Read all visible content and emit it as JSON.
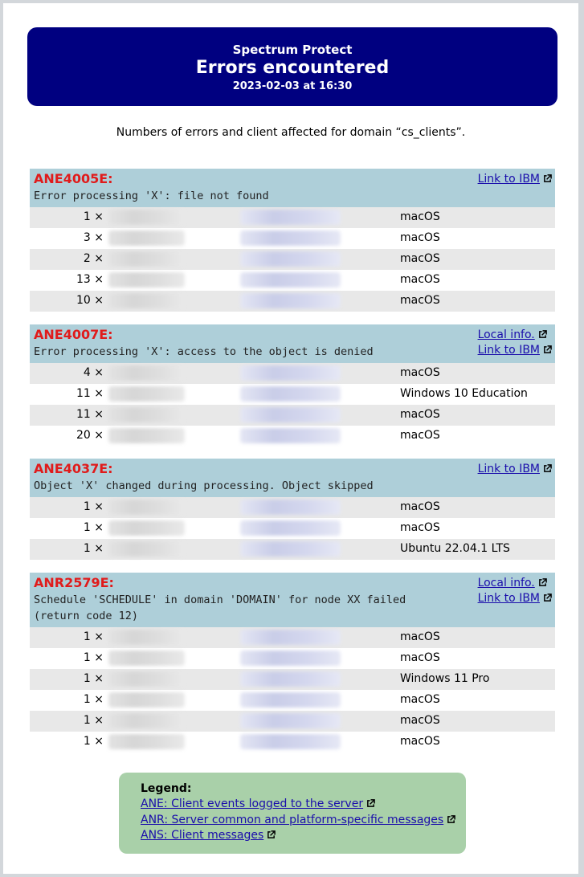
{
  "header": {
    "app": "Spectrum Protect",
    "title": "Errors encountered",
    "datetime": "2023-02-03 at 16:30"
  },
  "subtitle": "Numbers of errors and client affected for domain “cs_clients”.",
  "colors": {
    "banner": "#000080",
    "error_code": "#e01b1b",
    "group_header": "#aecfd9",
    "legend_bg": "#a9d0a9",
    "link": "#1a0dab"
  },
  "groups": [
    {
      "code": "ANE4005E:",
      "description": "Error processing 'X': file not found",
      "links": [
        "Link to IBM"
      ],
      "rows": [
        {
          "count": "1 ×",
          "os": "macOS"
        },
        {
          "count": "3 ×",
          "os": "macOS"
        },
        {
          "count": "2 ×",
          "os": "macOS"
        },
        {
          "count": "13 ×",
          "os": "macOS"
        },
        {
          "count": "10 ×",
          "os": "macOS"
        }
      ]
    },
    {
      "code": "ANE4007E:",
      "description": "Error processing 'X': access to the object is denied",
      "links": [
        "Local info.",
        "Link to IBM"
      ],
      "rows": [
        {
          "count": "4 ×",
          "os": "macOS"
        },
        {
          "count": "11 ×",
          "os": "Windows 10 Education"
        },
        {
          "count": "11 ×",
          "os": "macOS"
        },
        {
          "count": "20 ×",
          "os": "macOS"
        }
      ]
    },
    {
      "code": "ANE4037E:",
      "description": "Object 'X' changed during processing. Object skipped",
      "links": [
        "Link to IBM"
      ],
      "rows": [
        {
          "count": "1 ×",
          "os": "macOS"
        },
        {
          "count": "1 ×",
          "os": "macOS"
        },
        {
          "count": "1 ×",
          "os": "Ubuntu 22.04.1 LTS"
        }
      ]
    },
    {
      "code": "ANR2579E:",
      "description": "Schedule 'SCHEDULE' in domain 'DOMAIN' for node XX failed (return code 12)",
      "description_lines": [
        "Schedule 'SCHEDULE' in domain 'DOMAIN' for node XX failed",
        "(return code 12)"
      ],
      "links": [
        "Local info.",
        "Link to IBM"
      ],
      "rows": [
        {
          "count": "1 ×",
          "os": "macOS"
        },
        {
          "count": "1 ×",
          "os": "macOS"
        },
        {
          "count": "1 ×",
          "os": "Windows 11 Pro"
        },
        {
          "count": "1 ×",
          "os": "macOS"
        },
        {
          "count": "1 ×",
          "os": "macOS"
        },
        {
          "count": "1 ×",
          "os": "macOS"
        }
      ]
    }
  ],
  "legend": {
    "title": "Legend:",
    "items": [
      "ANE: Client events logged to the server",
      "ANR: Server common and platform-specific messages",
      "ANS: Client messages"
    ]
  },
  "icons": {
    "external_link": "external-link-icon"
  }
}
